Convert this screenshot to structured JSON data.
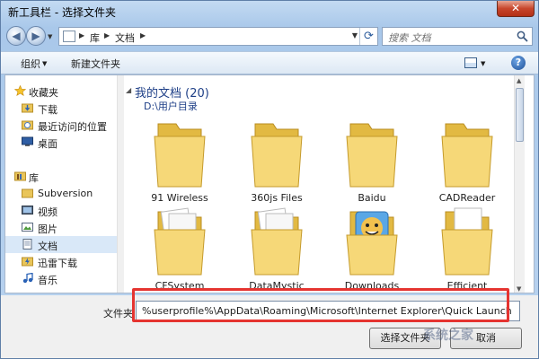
{
  "window": {
    "title": "新工具栏 - 选择文件夹",
    "close_glyph": "✕"
  },
  "address": {
    "crumbs": [
      "库",
      "文档"
    ],
    "search_placeholder": "搜索 文档"
  },
  "toolbar": {
    "organize": "组织",
    "new_folder": "新建文件夹",
    "help": "?"
  },
  "sidebar": {
    "items": [
      {
        "label": "收藏夹",
        "icon": "star-icon"
      },
      {
        "label": "下载",
        "icon": "download-folder-icon"
      },
      {
        "label": "最近访问的位置",
        "icon": "recent-places-icon"
      },
      {
        "label": "桌面",
        "icon": "desktop-icon"
      },
      {
        "label": "库",
        "icon": "library-icon"
      },
      {
        "label": "Subversion",
        "icon": "library-folder-icon"
      },
      {
        "label": "视频",
        "icon": "video-icon"
      },
      {
        "label": "图片",
        "icon": "pictures-icon"
      },
      {
        "label": "文档",
        "icon": "documents-icon"
      },
      {
        "label": "迅雷下载",
        "icon": "thunder-download-icon"
      },
      {
        "label": "音乐",
        "icon": "music-icon"
      }
    ]
  },
  "content": {
    "library_title": "我的文档 (20)",
    "library_path": "D:\\用户目录",
    "folders": [
      {
        "name": "91 Wireless",
        "icon": "folder-icon"
      },
      {
        "name": "360js Files",
        "icon": "folder-icon"
      },
      {
        "name": "Baidu",
        "icon": "folder-icon"
      },
      {
        "name": "CADReader",
        "icon": "folder-icon"
      },
      {
        "name": "CFSystem",
        "icon": "folder-with-pages-icon"
      },
      {
        "name": "DataMystic",
        "icon": "folder-with-pages-icon"
      },
      {
        "name": "Downloads",
        "icon": "downloads-folder-icon"
      },
      {
        "name": "Efficient",
        "icon": "folder-with-pages-icon"
      }
    ]
  },
  "bottom": {
    "folder_label": "文件夹",
    "folder_value": "%userprofile%\\AppData\\Roaming\\Microsoft\\Internet Explorer\\Quick Launch",
    "ok_label": "选择文件夹",
    "cancel_label": "取消"
  },
  "watermark": "系统之家",
  "colors": {
    "highlight": "#e53430",
    "link": "#1e3f87",
    "selection": "#d9e8f8"
  }
}
